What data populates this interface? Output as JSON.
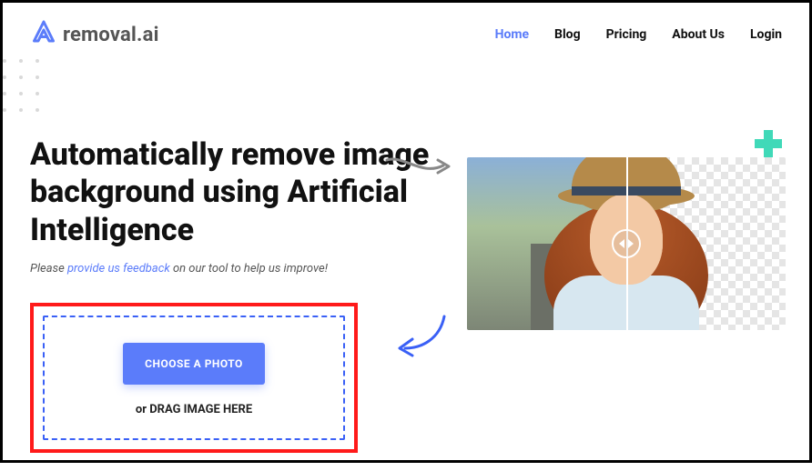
{
  "brand": {
    "name": "removal.ai"
  },
  "nav": {
    "home": "Home",
    "blog": "Blog",
    "pricing": "Pricing",
    "about": "About Us",
    "login": "Login"
  },
  "hero": {
    "headline": "Automatically remove image background using Artificial Intelligence",
    "sub_prefix": "Please ",
    "sub_link": "provide us feedback",
    "sub_suffix": " on our tool to help us improve!"
  },
  "upload": {
    "button": "CHOOSE A PHOTO",
    "drag_text": "or DRAG IMAGE HERE"
  }
}
